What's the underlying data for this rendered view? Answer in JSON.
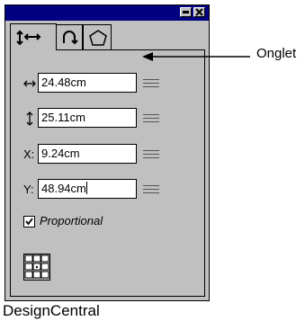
{
  "window": {
    "tabs": [
      {
        "name": "position",
        "active": true
      },
      {
        "name": "rotate",
        "active": false
      },
      {
        "name": "shape",
        "active": false
      }
    ],
    "fields": [
      {
        "label_icon": "horizontal-arrow-icon",
        "value": "24.48cm"
      },
      {
        "label_icon": "vertical-arrow-icon",
        "value": "25.11cm"
      },
      {
        "label": "X:",
        "value": "9.24cm"
      },
      {
        "label": "Y:",
        "value": "48.94cm"
      }
    ],
    "proportional": {
      "label": "Proportional",
      "checked": true
    }
  },
  "callout": {
    "label": "Onglet"
  },
  "caption": "DesignCentral"
}
